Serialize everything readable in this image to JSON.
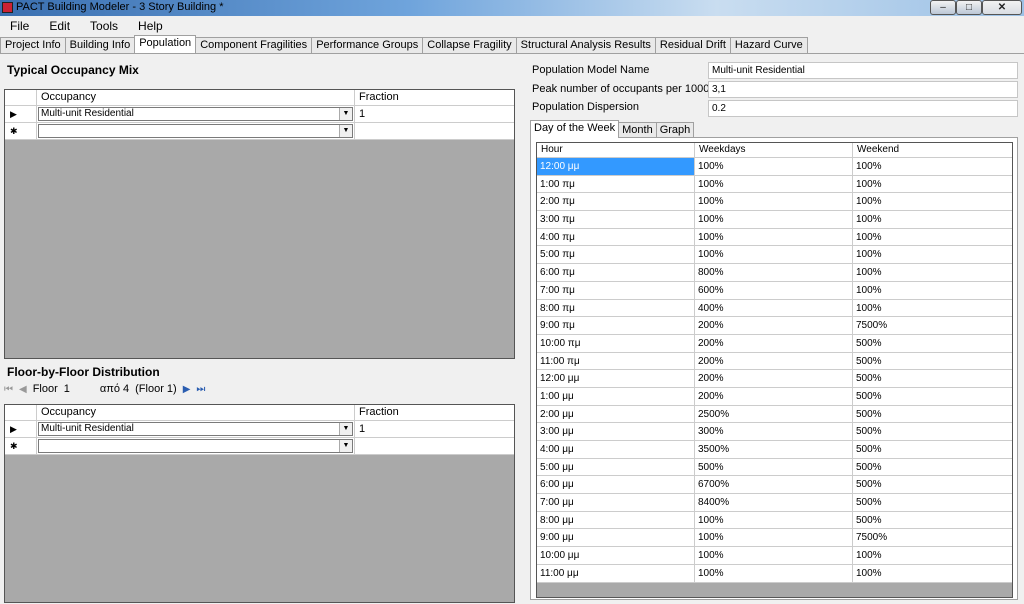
{
  "window": {
    "title": "PACT Building Modeler - 3 Story Building *",
    "minimize": "–",
    "maximize": "□",
    "close": "✕"
  },
  "menu": [
    "File",
    "Edit",
    "Tools",
    "Help"
  ],
  "tabs": [
    {
      "label": "Project Info",
      "active": false
    },
    {
      "label": "Building Info",
      "active": false
    },
    {
      "label": "Population",
      "active": true
    },
    {
      "label": "Component Fragilities",
      "active": false
    },
    {
      "label": "Performance Groups",
      "active": false
    },
    {
      "label": "Collapse Fragility",
      "active": false
    },
    {
      "label": "Structural Analysis Results",
      "active": false
    },
    {
      "label": "Residual Drift",
      "active": false
    },
    {
      "label": "Hazard Curve",
      "active": false
    }
  ],
  "typical": {
    "title": "Typical Occupancy Mix",
    "col_occupancy": "Occupancy",
    "col_fraction": "Fraction",
    "row_occupancy": "Multi-unit Residential",
    "row_fraction": "1",
    "row_marker": "▶",
    "new_marker": "✱"
  },
  "floor": {
    "title": "Floor-by-Floor Distribution",
    "nav_first": "⏮",
    "nav_prev": "◀",
    "floor_label": "Floor",
    "floor_value": "1",
    "of_text": "από 4",
    "floor_name": "(Floor 1)",
    "nav_next": "▶",
    "nav_last": "⏭",
    "col_occupancy": "Occupancy",
    "col_fraction": "Fraction",
    "row_occupancy": "Multi-unit Residential",
    "row_fraction": "1",
    "row_marker": "▶",
    "new_marker": "✱"
  },
  "model": {
    "name_label": "Population Model Name",
    "name_value": "Multi-unit Residential",
    "peak_label": "Peak number of occupants per 1000sf",
    "peak_value": "3,1",
    "dispersion_label": "Population Dispersion",
    "dispersion_value": "0.2"
  },
  "subtabs": [
    {
      "label": "Day of the Week",
      "active": true
    },
    {
      "label": "Month",
      "active": false
    },
    {
      "label": "Graph",
      "active": false
    }
  ],
  "hour_table": {
    "headers": [
      "Hour",
      "Weekdays",
      "Weekend"
    ],
    "rows": [
      [
        "12:00 μμ",
        "100%",
        "100%"
      ],
      [
        "1:00 πμ",
        "100%",
        "100%"
      ],
      [
        "2:00 πμ",
        "100%",
        "100%"
      ],
      [
        "3:00 πμ",
        "100%",
        "100%"
      ],
      [
        "4:00 πμ",
        "100%",
        "100%"
      ],
      [
        "5:00 πμ",
        "100%",
        "100%"
      ],
      [
        "6:00 πμ",
        "800%",
        "100%"
      ],
      [
        "7:00 πμ",
        "600%",
        "100%"
      ],
      [
        "8:00 πμ",
        "400%",
        "100%"
      ],
      [
        "9:00 πμ",
        "200%",
        "7500%"
      ],
      [
        "10:00 πμ",
        "200%",
        "500%"
      ],
      [
        "11:00 πμ",
        "200%",
        "500%"
      ],
      [
        "12:00 μμ",
        "200%",
        "500%"
      ],
      [
        "1:00 μμ",
        "200%",
        "500%"
      ],
      [
        "2:00 μμ",
        "2500%",
        "500%"
      ],
      [
        "3:00 μμ",
        "300%",
        "500%"
      ],
      [
        "4:00 μμ",
        "3500%",
        "500%"
      ],
      [
        "5:00 μμ",
        "500%",
        "500%"
      ],
      [
        "6:00 μμ",
        "6700%",
        "500%"
      ],
      [
        "7:00 μμ",
        "8400%",
        "500%"
      ],
      [
        "8:00 μμ",
        "100%",
        "500%"
      ],
      [
        "9:00 μμ",
        "100%",
        "7500%"
      ],
      [
        "10:00 μμ",
        "100%",
        "100%"
      ],
      [
        "11:00 μμ",
        "100%",
        "100%"
      ]
    ]
  }
}
